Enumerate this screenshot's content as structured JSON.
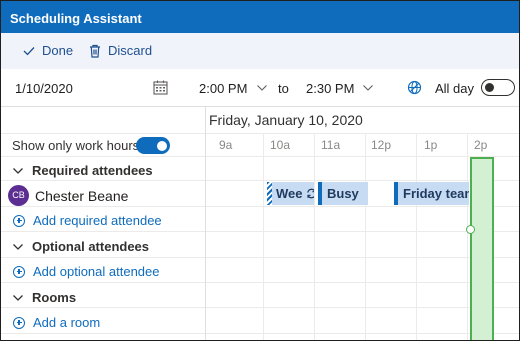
{
  "window": {
    "title": "Scheduling Assistant"
  },
  "toolbar": {
    "done_label": "Done",
    "discard_label": "Discard"
  },
  "datetime": {
    "date": "1/10/2020",
    "start_time": "2:00 PM",
    "to_label": "to",
    "end_time": "2:30 PM",
    "allday_label": "All day",
    "allday_on": false
  },
  "schedule": {
    "day_label": "Friday, January 10, 2020",
    "hours": [
      "9a",
      "10a",
      "11a",
      "12p",
      "1p",
      "2p"
    ],
    "work_hours_label": "Show only work hours",
    "work_hours_on": true
  },
  "sections": {
    "required": "Required attendees",
    "optional": "Optional attendees",
    "rooms": "Rooms"
  },
  "attendees": [
    {
      "initials": "CB",
      "name": "Chester Beane"
    }
  ],
  "links": {
    "add_required": "Add required attendee",
    "add_optional": "Add optional attendee",
    "add_room": "Add a room"
  },
  "events": [
    {
      "label": "Wee",
      "status": "tentative",
      "recurring": true
    },
    {
      "label": "Busy",
      "status": "busy"
    },
    {
      "label": "Friday team",
      "status": "busy"
    }
  ],
  "colors": {
    "accent": "#0f6cbd",
    "avatar": "#5c2e91",
    "selection": "#4caf50"
  }
}
